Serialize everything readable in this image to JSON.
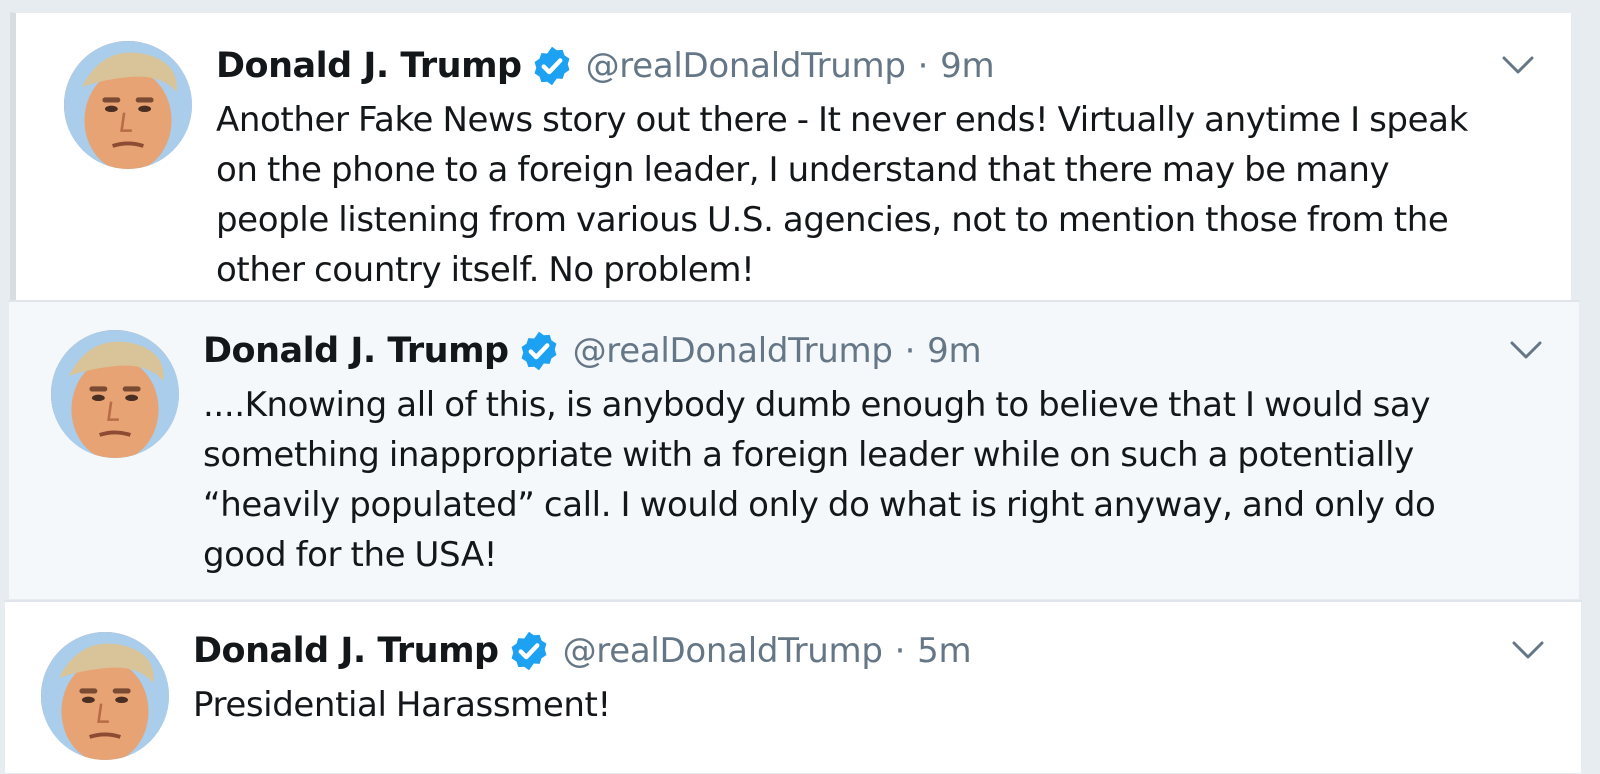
{
  "colors": {
    "name": "#14171a",
    "meta": "#657786",
    "verified": "#1da1f2",
    "background_highlight": "#f5f8fa"
  },
  "tweets": [
    {
      "name": "Donald J. Trump",
      "handle": "@realDonaldTrump",
      "separator": "·",
      "time": "9m",
      "lines": [
        "Another Fake News story out there - It never ends! Virtually anytime I speak",
        "on the phone to a foreign leader, I understand that there may be many",
        "people listening from various U.S. agencies, not to mention those from the",
        "other country itself. No problem!"
      ]
    },
    {
      "name": "Donald J. Trump",
      "handle": "@realDonaldTrump",
      "separator": "·",
      "time": "9m",
      "lines": [
        "....Knowing all of this, is anybody dumb enough to believe that I would say",
        "something inappropriate with a foreign leader while on such a potentially",
        "“heavily populated” call. I would only do what is right anyway, and only do",
        "good for the USA!"
      ]
    },
    {
      "name": "Donald J. Trump",
      "handle": "@realDonaldTrump",
      "separator": "·",
      "time": "5m",
      "lines": [
        "Presidential Harassment!"
      ]
    }
  ],
  "icons": {
    "verified": "verified-badge-icon",
    "caret": "chevron-down-icon"
  }
}
